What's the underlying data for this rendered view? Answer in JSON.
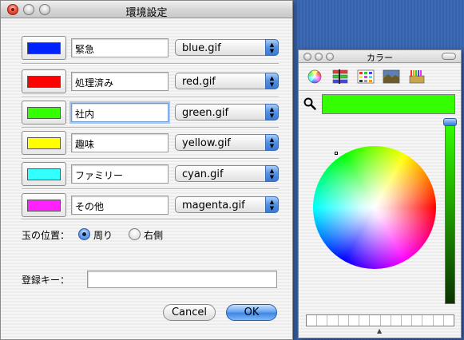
{
  "main_window": {
    "title": "環境設定",
    "rows": [
      {
        "color": "#0022ff",
        "name": "緊急",
        "file": "blue.gif"
      },
      {
        "color": "#ff0000",
        "name": "処理済み",
        "file": "red.gif"
      },
      {
        "color": "#33ff00",
        "name": "社内",
        "file": "green.gif"
      },
      {
        "color": "#ffff00",
        "name": "趣味",
        "file": "yellow.gif"
      },
      {
        "color": "#33ffff",
        "name": "ファミリー",
        "file": "cyan.gif"
      },
      {
        "color": "#ff22ff",
        "name": "その他",
        "file": "magenta.gif"
      }
    ],
    "ball_position_label": "玉の位置：",
    "radio_options": [
      {
        "label": "周り",
        "selected": true
      },
      {
        "label": "右側",
        "selected": false
      }
    ],
    "registration_key_label": "登録キー：",
    "registration_key_value": "",
    "cancel_label": "Cancel",
    "ok_label": "OK"
  },
  "color_panel": {
    "title": "カラー",
    "selected_color": "#33ff00",
    "icons": [
      "color-wheel-icon",
      "color-sliders-icon",
      "color-palettes-icon",
      "image-palettes-icon",
      "crayons-icon",
      "magnifier-icon"
    ]
  }
}
